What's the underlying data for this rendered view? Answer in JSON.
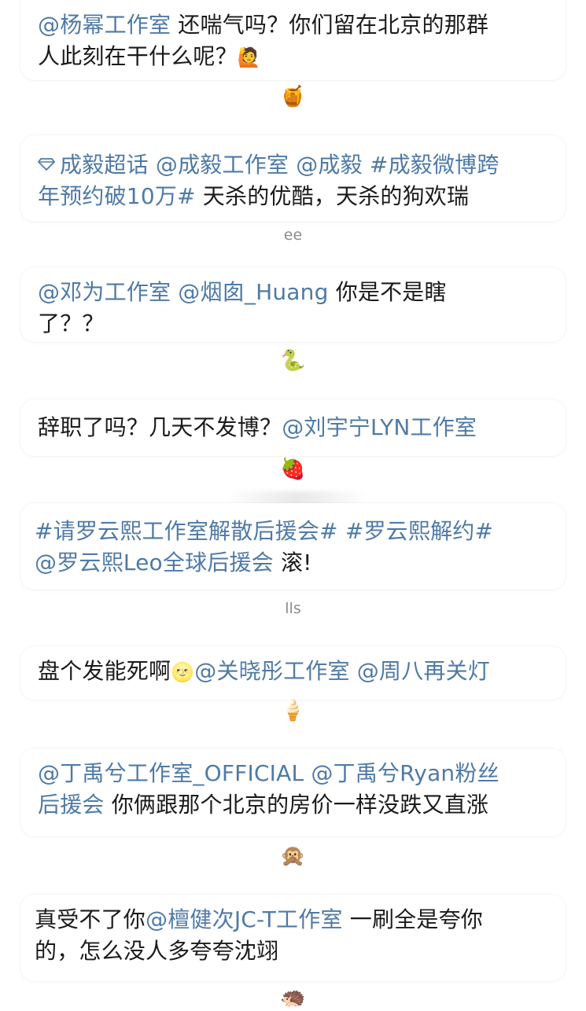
{
  "comments": [
    {
      "line1": [
        "@杨幂工作室",
        " 还喘气吗？你们留在北京的那群"
      ],
      "line2": [
        "人此刻在干什么呢？",
        "🙋"
      ],
      "separator": "🍯"
    },
    {
      "line1": [
        "成毅超话 @成毅工作室 @成毅  #成毅微博跨"
      ],
      "line2": [
        "年预约破10万#",
        " 天杀的优酷，天杀的狗欢瑞"
      ],
      "separator": "ee"
    },
    {
      "line1": [
        "@邓为工作室 @烟囱_Huang",
        " 你是不是瞎"
      ],
      "line2": [
        "了？？"
      ],
      "separator": "🐍"
    },
    {
      "line1": [
        "辞职了吗？几天不发博？",
        "@刘宇宁LYN工作室"
      ],
      "separator": "🍓"
    },
    {
      "line1": [
        "#请罗云熙工作室解散后援会# #罗云熙解约#"
      ],
      "line2": [
        "@罗云熙Leo全球后援会",
        " 滚!"
      ],
      "separator": "lls"
    },
    {
      "line1": [
        "盘个发能死啊",
        "🌝",
        "@关晓彤工作室  @周八再关灯"
      ],
      "separator": "🍦"
    },
    {
      "line1": [
        "@丁禹兮工作室_OFFICIAL @丁禹兮Ryan粉丝"
      ],
      "line2": [
        "后援会",
        " 你俩跟那个北京的房价一样没跌又直涨"
      ],
      "separator": "🙊"
    },
    {
      "line1": [
        "真受不了你",
        "@檀健次JC-T工作室",
        " 一刷全是夸你"
      ],
      "line2": [
        "的，怎么没人多夸夸沈翊"
      ],
      "separator": "🦔"
    }
  ],
  "icons": {
    "super_topic": "gem-icon"
  },
  "colors": {
    "mention": "#4f7aa6",
    "text": "#1b1b1b",
    "background": "#ffffff"
  }
}
